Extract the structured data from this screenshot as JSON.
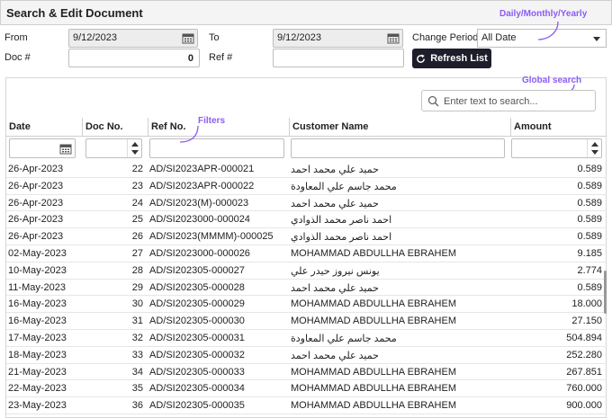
{
  "window": {
    "title": "Search & Edit Document"
  },
  "form": {
    "from_label": "From",
    "from_value": "9/12/2023",
    "to_label": "To",
    "to_value": "9/12/2023",
    "doc_label": "Doc #",
    "doc_value": "0",
    "ref_label": "Ref #",
    "ref_value": "",
    "period_label": "Change Period",
    "period_value": "All Date",
    "refresh_label": "Refresh List"
  },
  "annotations": {
    "period_note": "Daily/Monthly/Yearly",
    "search_note": "Global search",
    "filter_note": "Filters"
  },
  "search": {
    "placeholder": "Enter text to search..."
  },
  "table": {
    "columns": [
      "Date",
      "Doc No.",
      "Ref No.",
      "Customer Name",
      "Amount"
    ],
    "rows": [
      [
        "26-Apr-2023",
        "22",
        "AD/SI2023APR-000021",
        "حميد علي محمد احمد",
        "0.589"
      ],
      [
        "26-Apr-2023",
        "23",
        "AD/SI2023APR-000022",
        "محمد جاسم علي المعاودة",
        "0.589"
      ],
      [
        "26-Apr-2023",
        "24",
        "AD/SI2023(M)-000023",
        "حميد علي محمد احمد",
        "0.589"
      ],
      [
        "26-Apr-2023",
        "25",
        "AD/SI2023000-000024",
        "احمد ناصر محمد الذوادي",
        "0.589"
      ],
      [
        "26-Apr-2023",
        "26",
        "AD/SI2023(MMMM)-000025",
        "احمد ناصر محمد الذوادي",
        "0.589"
      ],
      [
        "02-May-2023",
        "27",
        "AD/SI2023000-000026",
        "MOHAMMAD ABDULLHA EBRAHEM",
        "9.185"
      ],
      [
        "10-May-2023",
        "28",
        "AD/SI202305-000027",
        "يونس نيروز حيدر علي",
        "2.774"
      ],
      [
        "11-May-2023",
        "29",
        "AD/SI202305-000028",
        "حميد علي محمد احمد",
        "0.589"
      ],
      [
        "16-May-2023",
        "30",
        "AD/SI202305-000029",
        "MOHAMMAD ABDULLHA EBRAHEM",
        "18.000"
      ],
      [
        "16-May-2023",
        "31",
        "AD/SI202305-000030",
        "MOHAMMAD ABDULLHA EBRAHEM",
        "27.150"
      ],
      [
        "17-May-2023",
        "32",
        "AD/SI202305-000031",
        "محمد جاسم علي المعاودة",
        "504.894"
      ],
      [
        "18-May-2023",
        "33",
        "AD/SI202305-000032",
        "حميد علي محمد احمد",
        "252.280"
      ],
      [
        "21-May-2023",
        "34",
        "AD/SI202305-000033",
        "MOHAMMAD ABDULLHA EBRAHEM",
        "267.851"
      ],
      [
        "22-May-2023",
        "35",
        "AD/SI202305-000034",
        "MOHAMMAD ABDULLHA EBRAHEM",
        "760.000"
      ],
      [
        "23-May-2023",
        "36",
        "AD/SI202305-000035",
        "MOHAMMAD ABDULLHA EBRAHEM",
        "900.000"
      ]
    ]
  },
  "icons": {
    "calendar": "calendar-icon",
    "search": "search-icon",
    "refresh": "refresh-icon"
  },
  "colors": {
    "accent": "#8b5cf6",
    "button_bg": "#1d1d2b"
  }
}
